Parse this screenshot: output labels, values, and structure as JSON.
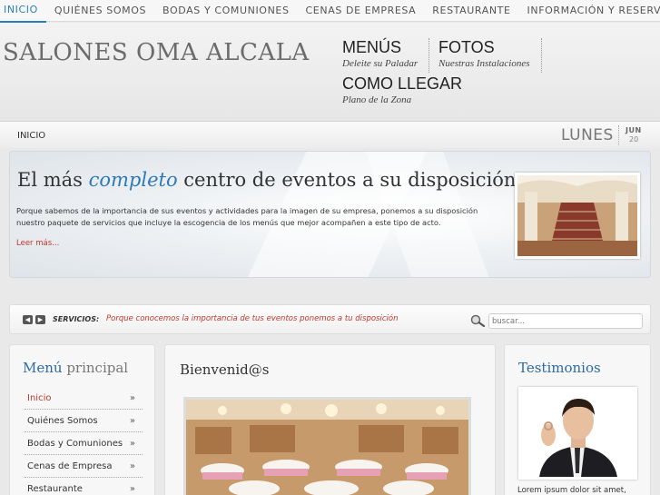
{
  "nav": {
    "items": [
      "INICIO",
      "QUIÉNES SOMOS",
      "BODAS Y COMUNIONES",
      "CENAS DE EMPRESA",
      "RESTAURANTE",
      "INFORMACIÓN Y RESERVAS"
    ],
    "active": "INICIO"
  },
  "header": {
    "logo": "SALONES OMA ALCALA",
    "menu": [
      {
        "title": "MENÚS",
        "subtitle": "Deleite su Paladar"
      },
      {
        "title": "FOTOS",
        "subtitle": "Nuestras Instalaciones"
      },
      {
        "title": "COMO LLEGAR",
        "subtitle": "Plano de la Zona"
      }
    ]
  },
  "breadcrumb": {
    "home": "INICIO",
    "day": "LUNES",
    "month": "JUN",
    "date": "20"
  },
  "hero": {
    "title_before": "El más ",
    "title_emphasis": "completo",
    "title_after": " centro de eventos a su disposición",
    "body": "Porque sabemos de la importancia de sus eventos y actividades para la imagen de su empresa, ponemos a su disposición nuestro paquete de servicios que incluye la escogencia de los menús que mejor acompañen a este tipo de acto.",
    "more": "Leer más..."
  },
  "services": {
    "label": "SERVICIOS:",
    "text": "Porque conocemos la importancia de tus eventos ponemos a tu disposición",
    "search_placeholder": "buscar..."
  },
  "sidebar": {
    "title_a": "Menú",
    "title_b": " principal",
    "items": [
      "Inicio",
      "Quiénes Somos",
      "Bodas y Comuniones",
      "Cenas de Empresa",
      "Restaurante"
    ],
    "chevron": "»"
  },
  "main": {
    "title": "Bienvenid@s"
  },
  "testimonials": {
    "title": "Testimonios",
    "text": "Lorem ipsum dolor sit amet,"
  },
  "colors": {
    "accent": "#2a7fb8",
    "link_red": "#c0392b"
  }
}
